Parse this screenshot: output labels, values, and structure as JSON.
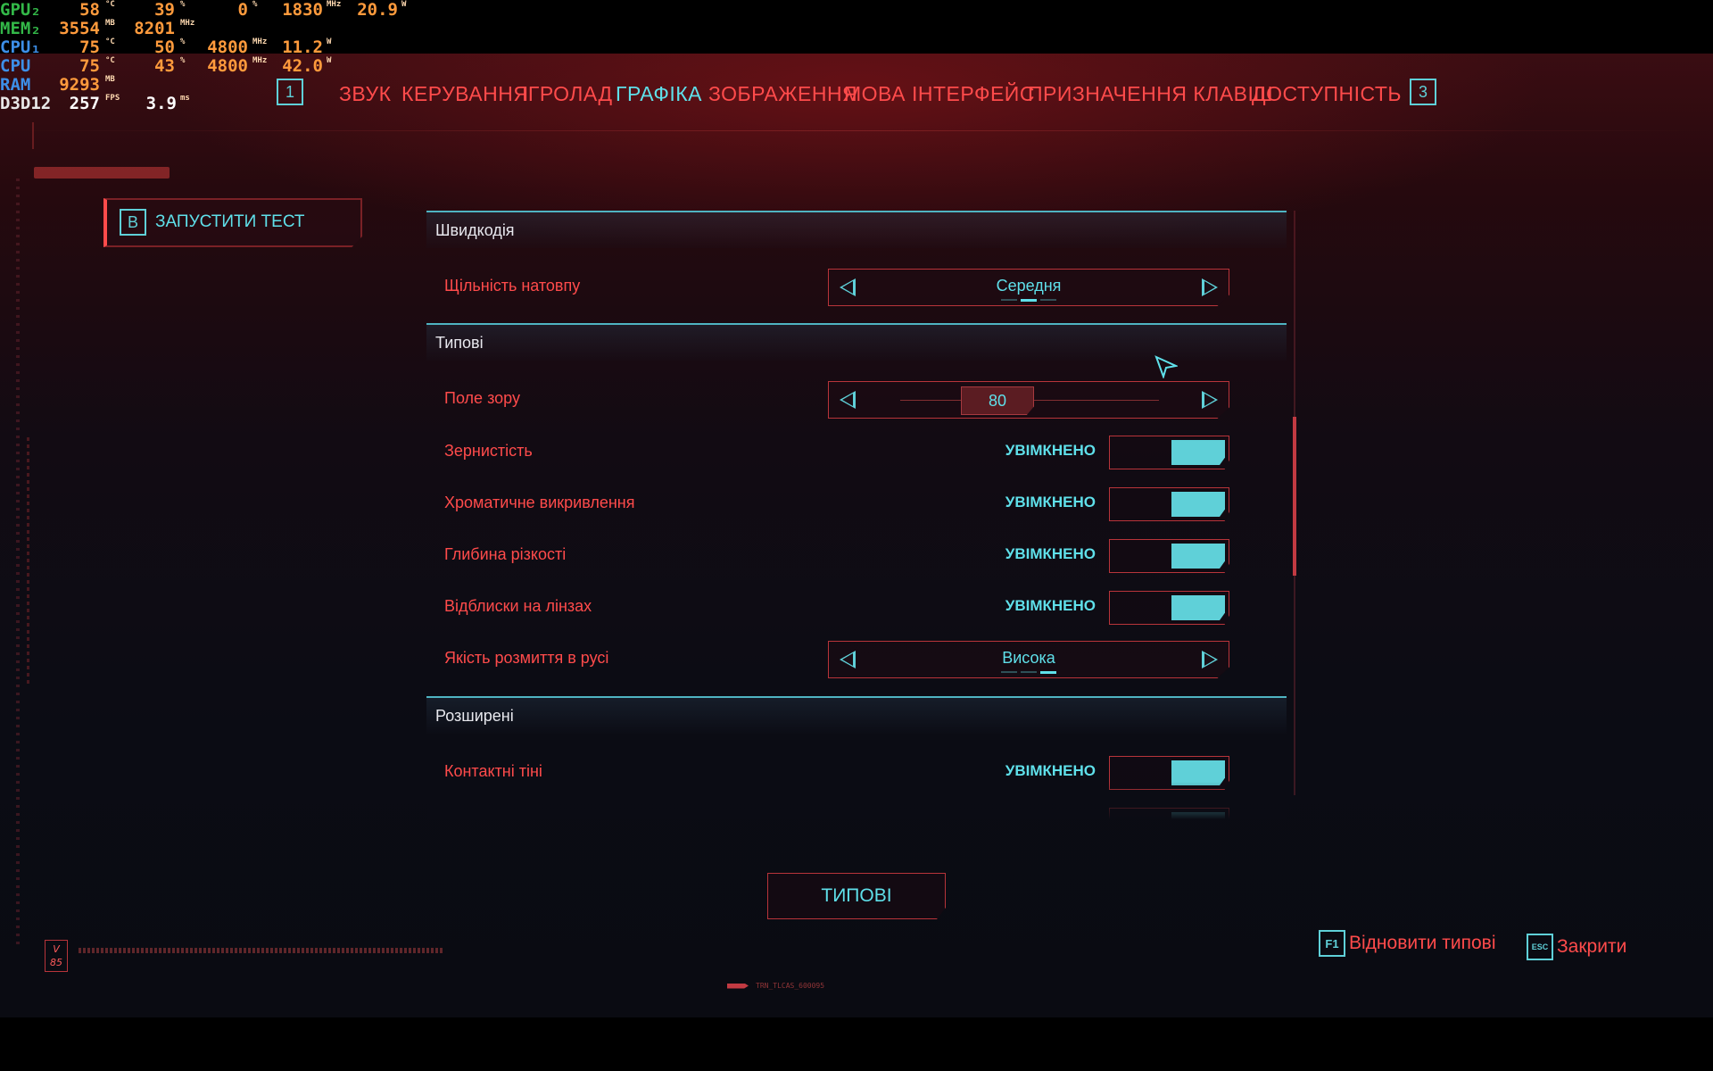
{
  "overlay": {
    "rows": [
      {
        "label": "GPU₂",
        "v1": "58",
        "u1": "°C",
        "v2": "39",
        "u2": "%",
        "v3": "0",
        "u3": "%",
        "v4": "1830",
        "u4": "MHz",
        "v5": "20.9",
        "u5": "W"
      },
      {
        "label": "MEM₂",
        "v1": "3554",
        "u1": "MB",
        "v2": "8201",
        "u2": "MHz"
      },
      {
        "label": "CPU₁",
        "v1": "75",
        "u1": "°C",
        "v2": "50",
        "u2": "%",
        "v3": "4800",
        "u3": "MHz",
        "v4": "11.2",
        "u4": "W"
      },
      {
        "label": "CPU",
        "v1": "75",
        "u1": "°C",
        "v2": "43",
        "u2": "%",
        "v3": "4800",
        "u3": "MHz",
        "v4": "42.0",
        "u4": "W"
      },
      {
        "label": "RAM",
        "v1": "9293",
        "u1": "MB"
      },
      {
        "label": "D3D12",
        "v1": "257",
        "u1": "FPS",
        "v2": "3.9",
        "u2": "ms"
      }
    ]
  },
  "nav": {
    "prev_key": "1",
    "next_key": "3",
    "tabs": [
      {
        "label": "ЗВУК",
        "active": false
      },
      {
        "label": "КЕРУВАННЯ",
        "active": false
      },
      {
        "label": "ІГРОЛАД",
        "active": false
      },
      {
        "label": "ГРАФІКА",
        "active": true
      },
      {
        "label": "ЗОБРАЖЕННЯ",
        "active": false
      },
      {
        "label": "МОВА",
        "active": false
      },
      {
        "label": "ІНТЕРФЕЙС",
        "active": false
      },
      {
        "label": "ПРИЗНАЧЕННЯ КЛАВІШ",
        "active": false
      },
      {
        "label": "ДОСТУПНІСТЬ",
        "active": false
      }
    ]
  },
  "benchmark": {
    "key": "B",
    "label": "ЗАПУСТИТИ ТЕСТ"
  },
  "settings": {
    "sections": [
      {
        "title": "Швидкодія"
      },
      {
        "title": "Типові"
      },
      {
        "title": "Розширені"
      }
    ],
    "crowd_density": {
      "label": "Щільність натовпу",
      "value": "Середня",
      "option_count": 3,
      "selected_index": 1
    },
    "fov": {
      "label": "Поле зору",
      "value": "80"
    },
    "film_grain": {
      "label": "Зернистість",
      "state": "УВІМКНЕНО"
    },
    "chromatic": {
      "label": "Хроматичне викривлення",
      "state": "УВІМКНЕНО"
    },
    "dof": {
      "label": "Глибина різкості",
      "state": "УВІМКНЕНО"
    },
    "lens_flare": {
      "label": "Відблиски на лінзах",
      "state": "УВІМКНЕНО"
    },
    "motion_blur": {
      "label": "Якість розмиття в русі",
      "value": "Висока",
      "option_count": 3,
      "selected_index": 2
    },
    "contact_shadows": {
      "label": "Контактні тіні",
      "state": "УВІМКНЕНО"
    }
  },
  "defaults_button": "ТИПОВІ",
  "hints": {
    "restore_key": "F1",
    "restore_label": "Відновити типові",
    "close_key": "ESC",
    "close_label": "Закрити"
  },
  "version": {
    "badge": "V 85",
    "build": "TRN_TLCAS_600095"
  },
  "colors": {
    "accent_cyan": "#5fe0ea",
    "accent_red": "#ff4b4b",
    "overlay_orange": "#ff9a3c"
  }
}
